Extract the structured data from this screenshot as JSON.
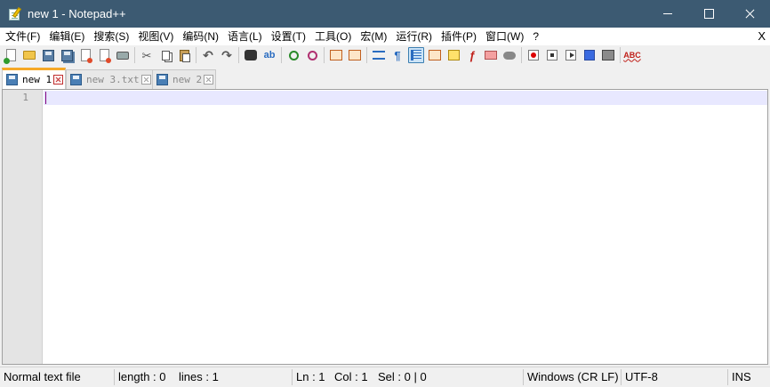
{
  "window": {
    "title": "new 1 - Notepad++"
  },
  "menu": {
    "items": [
      "文件(F)",
      "编辑(E)",
      "搜索(S)",
      "视图(V)",
      "编码(N)",
      "语言(L)",
      "设置(T)",
      "工具(O)",
      "宏(M)",
      "运行(R)",
      "插件(P)",
      "窗口(W)",
      "?"
    ],
    "close_label": "X"
  },
  "toolbar": {
    "buttons": [
      "new-file",
      "open-file",
      "save",
      "save-all",
      "close",
      "close-all",
      "print",
      "cut",
      "copy",
      "paste",
      "undo",
      "redo",
      "find",
      "replace",
      "zoom-in",
      "zoom-out",
      "sync-vertical",
      "sync-horizontal",
      "word-wrap",
      "show-all-characters",
      "indent-guide",
      "document-map",
      "function-list",
      "folder-as-workspace",
      "cloud",
      "start-recording",
      "stop-recording",
      "playback",
      "run-macro-multiple",
      "save-macro",
      "spell-check"
    ],
    "active": "indent-guide",
    "spell_label": "ABC"
  },
  "tabs": [
    {
      "label": "new 1",
      "active": true
    },
    {
      "label": "new 3.txt",
      "active": false
    },
    {
      "label": "new 2",
      "active": false
    }
  ],
  "editor": {
    "line_numbers": [
      "1"
    ],
    "content": ""
  },
  "statusbar": {
    "file_type": "Normal text file",
    "length": "length : 0",
    "lines": "lines : 1",
    "ln": "Ln : 1",
    "col": "Col : 1",
    "sel": "Sel : 0 | 0",
    "eol": "Windows (CR LF)",
    "encoding": "UTF-8",
    "mode": "INS"
  },
  "colors": {
    "titlebar": "#3c5a72",
    "active_tab_accent": "#f6a826",
    "current_line": "#e8e8ff",
    "caret": "#800080"
  }
}
